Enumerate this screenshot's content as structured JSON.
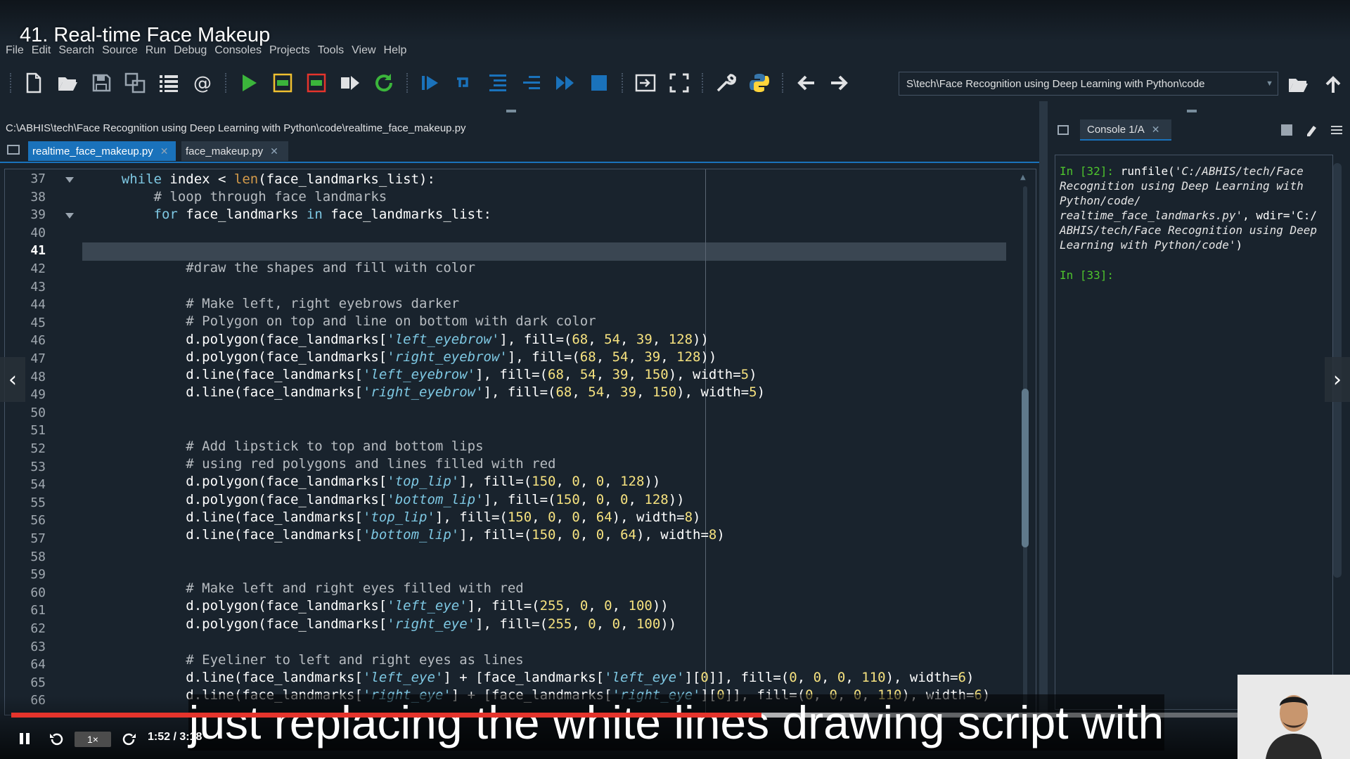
{
  "video": {
    "title": "41. Real-time Face Makeup",
    "subtitle": "just replacing the white lines drawing script with",
    "time": "1:52 / 3:18",
    "speed": "1×",
    "progress": 0.565
  },
  "menu": [
    "File",
    "Edit",
    "Search",
    "Source",
    "Run",
    "Debug",
    "Consoles",
    "Projects",
    "Tools",
    "View",
    "Help"
  ],
  "toolbar": {
    "working_dir": "S\\tech\\Face Recognition using Deep Learning with Python\\code"
  },
  "editor": {
    "file_path": "C:\\ABHIS\\tech\\Face Recognition using Deep Learning with Python\\code\\realtime_face_makeup.py",
    "tabs": [
      {
        "label": "realtime_face_makeup.py",
        "active": true
      },
      {
        "label": "face_makeup.py",
        "active": false
      }
    ],
    "current_line": "41",
    "line_numbers": [
      "37",
      "38",
      "39",
      "40",
      "41",
      "42",
      "43",
      "44",
      "45",
      "46",
      "47",
      "48",
      "49",
      "50",
      "51",
      "52",
      "53",
      "54",
      "55",
      "56",
      "57",
      "58",
      "59",
      "60",
      "61",
      "62",
      "63",
      "64",
      "65",
      "66"
    ]
  },
  "console": {
    "tab_label": "Console 1/A",
    "prompt1": "In [32]:",
    "cmd_func": "runfile(",
    "cmd_lines": [
      "'C:/ABHIS/tech/Face",
      "Recognition using Deep Learning with",
      "Python/code/",
      "realtime_face_landmarks.py'",
      "ABHIS/tech/Face Recognition using Deep",
      "Learning with Python/code'"
    ],
    "wdir_part": ", wdir='C:/",
    "prompt2": "In [33]:"
  },
  "colors": {
    "background": "#19232d",
    "accent": "#1a72bb",
    "progress": "#e5342c",
    "prompt": "#4ec42d"
  }
}
